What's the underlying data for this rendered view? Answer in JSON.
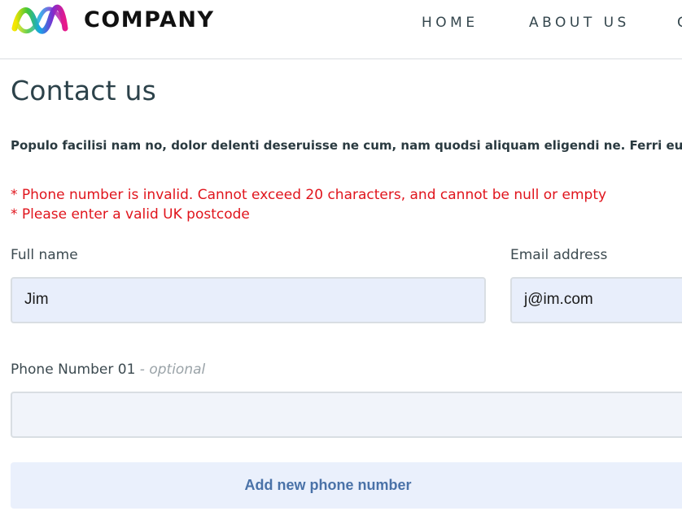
{
  "header": {
    "brand": "COMPANY",
    "nav": [
      "HOME",
      "ABOUT US",
      "C"
    ]
  },
  "page": {
    "title": "Contact us",
    "intro": "Populo facilisi nam no, dolor delenti deseruisse ne cum, nam quodsi aliquam eligendi ne. Ferri euism"
  },
  "errors": [
    "* Phone number is invalid. Cannot exceed 20 characters, and cannot be null or empty",
    "* Please enter a valid UK postcode"
  ],
  "form": {
    "full_name_label": "Full name",
    "full_name_value": "Jim",
    "email_label": "Email address",
    "email_value": "j@im.com",
    "phone_label": "Phone Number 01",
    "phone_optional": "- optional",
    "phone_value": "",
    "add_phone_label": "Add new phone number"
  },
  "colors": {
    "title": "#2c424a",
    "error": "#e0141c",
    "input_bg": "#e8eefb",
    "button_text": "#4a72a8"
  }
}
